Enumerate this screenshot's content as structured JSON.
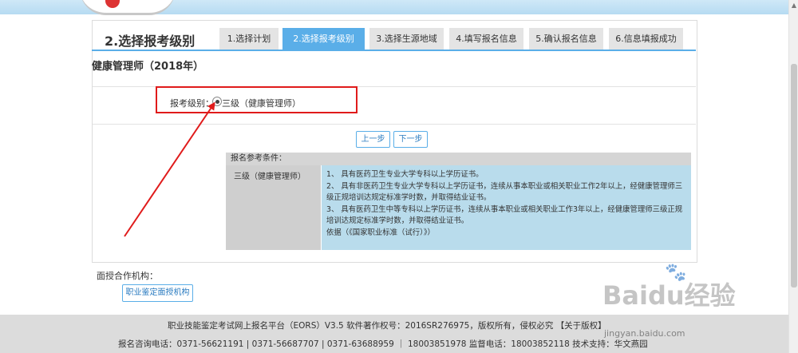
{
  "header": {
    "step_title": "2.选择报考级别"
  },
  "tabs": [
    {
      "label": "1.选择计划",
      "active": false
    },
    {
      "label": "2.选择报考级别",
      "active": true
    },
    {
      "label": "3.选择生源地域",
      "active": false
    },
    {
      "label": "4.填写报名信息",
      "active": false
    },
    {
      "label": "5.确认报名信息",
      "active": false
    },
    {
      "label": "6.信息填报成功",
      "active": false
    }
  ],
  "certificate": {
    "title": "健康管理师（2018年）"
  },
  "level": {
    "label": "报考级别：",
    "option": "三级（健康管理师）",
    "selected": true
  },
  "buttons": {
    "prev": "上一步",
    "next": "下一步"
  },
  "conditions": {
    "header": "报名参考条件：",
    "level": "三级（健康管理师）",
    "items": [
      "1、 具有医药卫生专业大学专科以上学历证书。",
      "2、 具有非医药卫生专业大学专科以上学历证书，连续从事本职业或相关职业工作2年以上，经健康管理师三级正规培训达规定标准学时数，并取得结业证书。",
      "3、 具有医药卫生中等专科以上学历证书，连续从事本职业或相关职业工作3年以上，经健康管理师三级正规培训达规定标准学时数，并取得结业证书。",
      "依据（《国家职业标准（试行）》）"
    ]
  },
  "orgs": {
    "label": "面授合作机构：",
    "button": "职业鉴定面授机构"
  },
  "footer": {
    "line1": "职业技能鉴定考试网上报名平台（EORS）V3.5 软件著作权号：2016SR276975，版权所有，侵权必究",
    "about": "【关于版权】",
    "line2": "报名咨询电话：0371-56621191 | 0371-56687707 | 0371-63688959 ｜ 18003851978 监督电话：18003852118 技术支持：华文燕园"
  },
  "watermark": {
    "text": "Baidu经验",
    "url": "jingyan.baidu.com"
  },
  "colors": {
    "accent": "#5aaee8",
    "highlight": "#e01b1b",
    "condition_bg": "#b9dcec"
  }
}
